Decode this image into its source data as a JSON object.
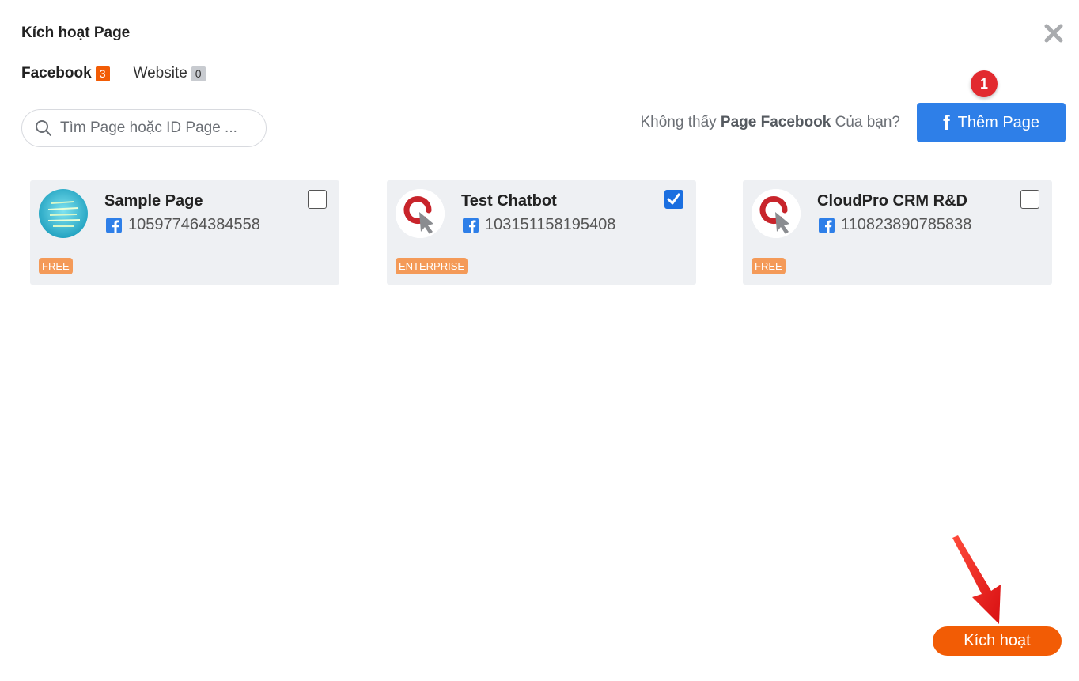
{
  "modal": {
    "title": "Kích hoạt Page",
    "close_icon": "close-icon"
  },
  "tabs": [
    {
      "label": "Facebook",
      "count": "3",
      "active": true
    },
    {
      "label": "Website",
      "count": "0",
      "active": false
    }
  ],
  "search": {
    "placeholder": "Tìm Page hoặc ID Page ..."
  },
  "notice": {
    "prefix": "Không thấy ",
    "bold": "Page Facebook",
    "suffix": " Của bạn?"
  },
  "add_page_button": {
    "icon": "facebook-f-icon",
    "label": "Thêm Page"
  },
  "step_badge": "1",
  "pages": [
    {
      "name": "Sample Page",
      "id": "105977464384558",
      "plan": "FREE",
      "checked": false
    },
    {
      "name": "Test Chatbot",
      "id": "103151158195408",
      "plan": "ENTERPRISE",
      "checked": true
    },
    {
      "name": "CloudPro CRM R&D",
      "id": "110823890785838",
      "plan": "FREE",
      "checked": false
    }
  ],
  "activate_button": {
    "label": "Kích hoạt"
  },
  "colors": {
    "accent_orange": "#f25c05",
    "facebook_blue": "#2e7fe8",
    "checkbox_blue": "#1b6fe0",
    "plan_badge": "#f49a58",
    "annotation_red": "#e22a2f"
  }
}
